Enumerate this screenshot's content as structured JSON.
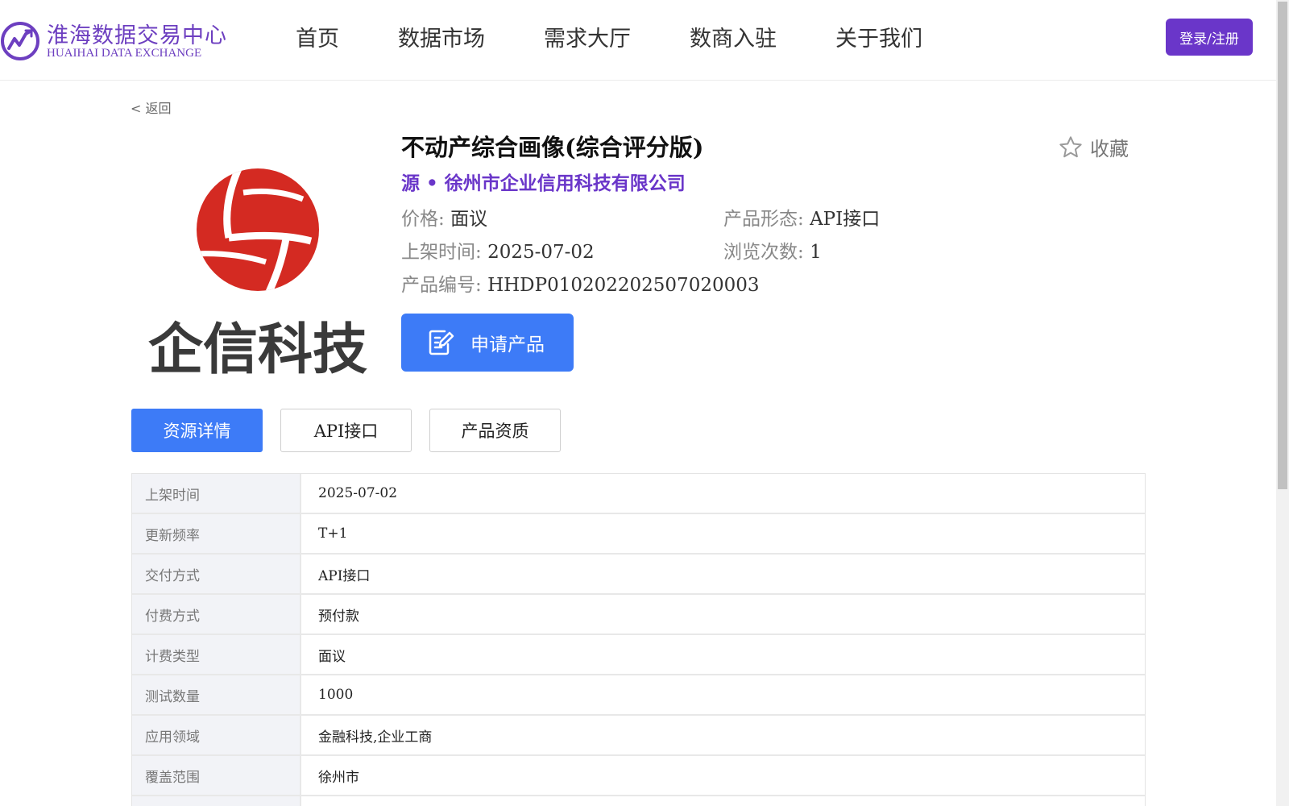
{
  "header": {
    "logo_cn": "淮海数据交易中心",
    "logo_en": "HUAIHAI DATA EXCHANGE",
    "nav": [
      "首页",
      "数据市场",
      "需求大厅",
      "数商入驻",
      "关于我们"
    ],
    "login_label": "登录/注册",
    "brand_color": "#6a36c9"
  },
  "back_label": "< 返回",
  "product": {
    "logo_text": "企信科技",
    "title": "不动产综合画像(综合评分版)",
    "favorite_label": "收藏",
    "source": "源 • 徐州市企业信用科技有限公司",
    "price_key": "价格:",
    "price_val": "面议",
    "form_key": "产品形态:",
    "form_val": "API接口",
    "listed_key": "上架时间:",
    "listed_val": "2025-07-02",
    "views_key": "浏览次数:",
    "views_val": "1",
    "code_key": "产品编号:",
    "code_val": "HHDP010202202507020003",
    "apply_label": "申请产品",
    "accent_color": "#3d7bf7"
  },
  "tabs": [
    "资源详情",
    "API接口",
    "产品资质"
  ],
  "details": [
    {
      "key": "上架时间",
      "value": "2025-07-02"
    },
    {
      "key": "更新频率",
      "value": "T+1"
    },
    {
      "key": "交付方式",
      "value": "API接口"
    },
    {
      "key": "付费方式",
      "value": "预付款"
    },
    {
      "key": "计费类型",
      "value": "面议"
    },
    {
      "key": "测试数量",
      "value": "1000"
    },
    {
      "key": "应用领域",
      "value": "金融科技,企业工商"
    },
    {
      "key": "覆盖范围",
      "value": "徐州市"
    },
    {
      "key": "",
      "value": ""
    }
  ]
}
